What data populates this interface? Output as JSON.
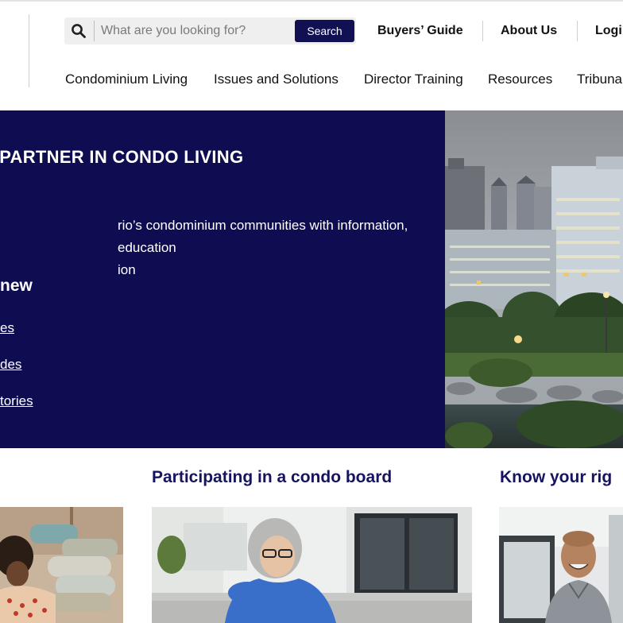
{
  "header": {
    "search": {
      "placeholder": "What are you looking for?",
      "button_label": "Search"
    },
    "utility_nav": [
      "Buyers’ Guide",
      "About Us",
      "Logi"
    ],
    "main_nav": [
      "Condominium Living",
      "Issues and Solutions",
      "Director Training",
      "Resources",
      "Tribuna"
    ]
  },
  "hero": {
    "title": "PARTNER IN CONDO LIVING",
    "description": "rio’s condominium communities with information, education\nion",
    "subheading": "new",
    "links": [
      "es",
      "des",
      "tories"
    ]
  },
  "cards": [
    {
      "title": ""
    },
    {
      "title": "Participating in a condo board"
    },
    {
      "title": "Know your rig"
    }
  ],
  "colors": {
    "brand_navy": "#0f0d52",
    "card_title": "#161460"
  }
}
